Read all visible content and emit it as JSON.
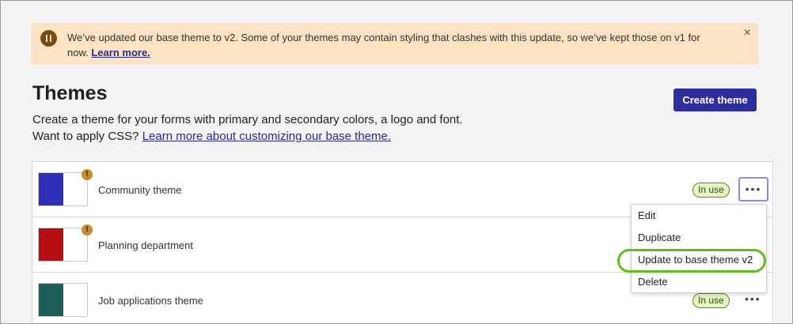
{
  "banner": {
    "message": "We’ve updated our base theme to v2. Some of your themes may contain styling that clashes with this update, so we’ve kept those on v1 for now.",
    "link_label": "Learn more.",
    "close_label": "×",
    "icon": "pause-icon"
  },
  "header": {
    "title": "Themes",
    "description_line1": "Create a theme for your forms with primary and secondary colors, a logo and font.",
    "description_line2_prefix": "Want to apply CSS?",
    "description_link": "Learn more about customizing our base theme.",
    "create_button": "Create theme"
  },
  "themes": [
    {
      "name": "Community theme",
      "primary_color": "#2e2eb8",
      "warning": "!",
      "badge": "In use",
      "more_label": "•••"
    },
    {
      "name": "Planning department",
      "primary_color": "#b80f14",
      "warning": "!",
      "badge": "",
      "more_label": ""
    },
    {
      "name": "Job applications theme",
      "primary_color": "#1e5f5a",
      "warning": "",
      "badge": "In use",
      "more_label": "•••"
    }
  ],
  "menu": {
    "items": [
      "Edit",
      "Duplicate",
      "Update to base theme v2",
      "Delete"
    ]
  },
  "colors": {
    "accent": "#2e2e9e",
    "banner_bg": "#fbe3c4",
    "badge_bg": "#e6f5c4",
    "highlight": "#5fbf1d"
  }
}
